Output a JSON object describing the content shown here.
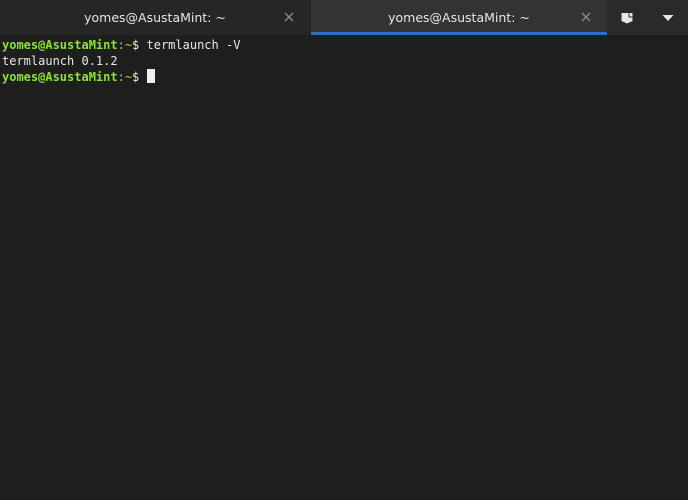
{
  "tabs": [
    {
      "label": "yomes@AsustaMint: ~",
      "active": false
    },
    {
      "label": "yomes@AsustaMint: ~",
      "active": true
    }
  ],
  "icons": {
    "tab_close": "close-icon",
    "new_tab": "new-tab-icon",
    "menu": "chevron-down-icon"
  },
  "colors": {
    "prompt": "#8ae234",
    "active_tab_indicator": "#2e6fc4",
    "background": "#1e1e1e"
  },
  "terminal": {
    "lines": [
      {
        "user_host": "yomes@AsustaMint",
        "path": ":~",
        "symbol": "$ ",
        "command": "termlaunch -V"
      },
      {
        "output": "termlaunch 0.1.2"
      },
      {
        "user_host": "yomes@AsustaMint",
        "path": ":~",
        "symbol": "$ ",
        "command": ""
      }
    ]
  }
}
